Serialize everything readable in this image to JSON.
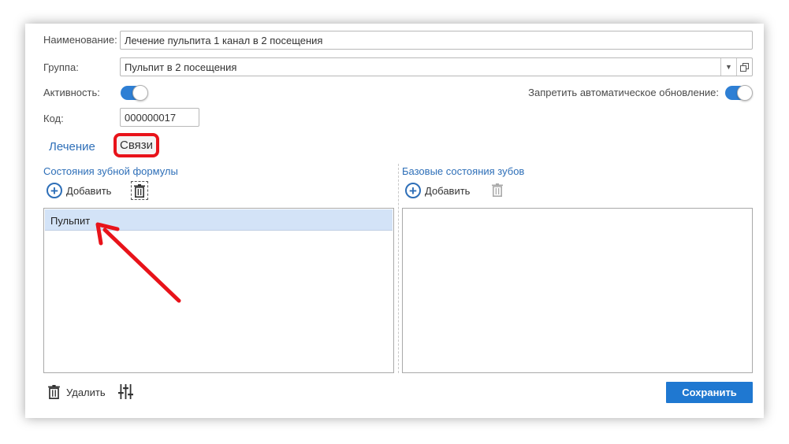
{
  "form": {
    "name_label": "Наименование:",
    "name_value": "Лечение пульпита 1 канал в 2 посещения",
    "group_label": "Группа:",
    "group_value": "Пульпит в 2 посещения",
    "activity_label": "Активность:",
    "activity_on": true,
    "auto_update_label": "Запретить автоматическое обновление:",
    "auto_update_on": true,
    "code_label": "Код:",
    "code_value": "000000017"
  },
  "tabs": [
    {
      "label": "Лечение",
      "active": false
    },
    {
      "label": "Связи",
      "active": true
    }
  ],
  "left_panel": {
    "title": "Состояния зубной формулы",
    "add_label": "Добавить",
    "items": [
      "Пульпит"
    ]
  },
  "right_panel": {
    "title": "Базовые состояния зубов",
    "add_label": "Добавить",
    "items": []
  },
  "footer": {
    "delete_label": "Удалить",
    "save_label": "Сохранить"
  },
  "colors": {
    "accent": "#1f78d1",
    "link": "#2e6fb8",
    "highlight": "#e8131a",
    "selected_row": "#d3e3f7"
  }
}
